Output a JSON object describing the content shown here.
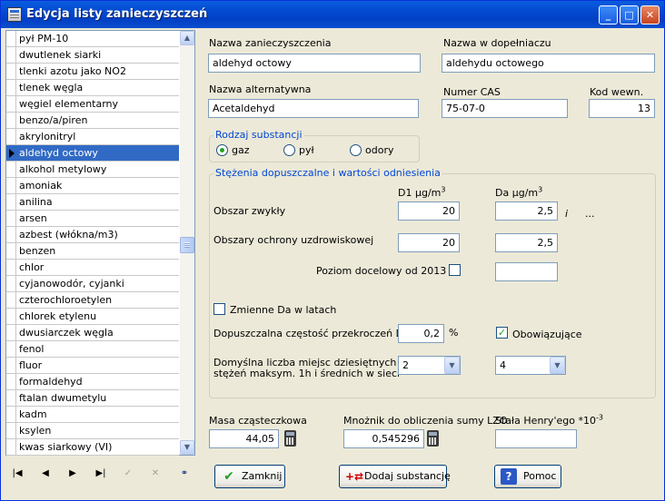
{
  "window": {
    "title": "Edycja listy zanieczyszczeń"
  },
  "list": {
    "items": [
      "pył PM-10",
      "dwutlenek siarki",
      "tlenki azotu jako NO2",
      "tlenek węgla",
      "węgiel elementarny",
      "benzo/a/piren",
      "akrylonitryl",
      "aldehyd octowy",
      "alkohol metylowy",
      "amoniak",
      "anilina",
      "arsen",
      "azbest (włókna/m3)",
      "benzen",
      "chlor",
      "cyjanowodór, cyjanki",
      "czterochloroetylen",
      "chlorek etylenu",
      "dwusiarczek węgla",
      "fenol",
      "fluor",
      "formaldehyd",
      "ftalan dwumetylu",
      "kadm",
      "ksylen",
      "kwas siarkowy (VI)"
    ],
    "selected_index": 7
  },
  "form": {
    "nazwa_label": "Nazwa zanieczyszczenia",
    "nazwa_value": "aldehyd octowy",
    "dopelniacz_label": "Nazwa w dopełniaczu",
    "dopelniacz_value": "aldehydu octowego",
    "alternatywna_label": "Nazwa alternatywna",
    "alternatywna_value": "Acetaldehyd",
    "cas_label": "Numer CAS",
    "cas_value": "75-07-0",
    "kod_label": "Kod wewn.",
    "kod_value": "13",
    "rodzaj": {
      "title": "Rodzaj substancji",
      "options": [
        "gaz",
        "pył",
        "odory"
      ],
      "selected": "gaz"
    },
    "stezenia": {
      "title": "Stężenia dopuszczalne i wartości odniesienia",
      "d1_header": "D1 μg/m",
      "da_header": "Da μg/m",
      "header_sup": "3",
      "obszar_label": "Obszar zwykły",
      "obszar_d1": "20",
      "obszar_da": "2,5",
      "obszar_suffix": "i",
      "obszar_ellipsis": "...",
      "uzdrow_label": "Obszary ochrony uzdrowiskowej",
      "uzdrow_d1": "20",
      "uzdrow_da": "2,5",
      "poziom_label": "Poziom docelowy od 2013 r",
      "poziom_checked": false,
      "poziom_value": "",
      "zmienne_label": "Zmienne Da w latach",
      "zmienne_checked": false,
      "czestosc_label": "Dopuszczalna częstość przekroczeń D1",
      "czestosc_value": "0,2",
      "czestosc_unit": "%",
      "obowiazujace_label": "Obowiązujące",
      "obowiazujace_checked": true,
      "domyslna_label_1": "Domyślna liczba miejsc dziesiętnych dla",
      "domyslna_label_2": "stężeń maksym. 1h i średnich  w sieci",
      "domyslna_d1": "2",
      "domyslna_da": "4"
    },
    "masa_label": "Masa cząsteczkowa",
    "masa_value": "44,05",
    "mnoznik_label": "Mnożnik do obliczenia sumy LZO",
    "mnoznik_value": "0,545296",
    "henry_label": "Stała Henry'ego *10",
    "henry_sup": "-3",
    "henry_value": ""
  },
  "buttons": {
    "zamknij": "Zamknij",
    "dodaj": "Dodaj substancję",
    "pomoc": "Pomoc"
  },
  "icons": {
    "title": "list-window-icon",
    "zamknij": "check-icon",
    "dodaj": "add-substance-icon",
    "pomoc": "help-icon"
  }
}
